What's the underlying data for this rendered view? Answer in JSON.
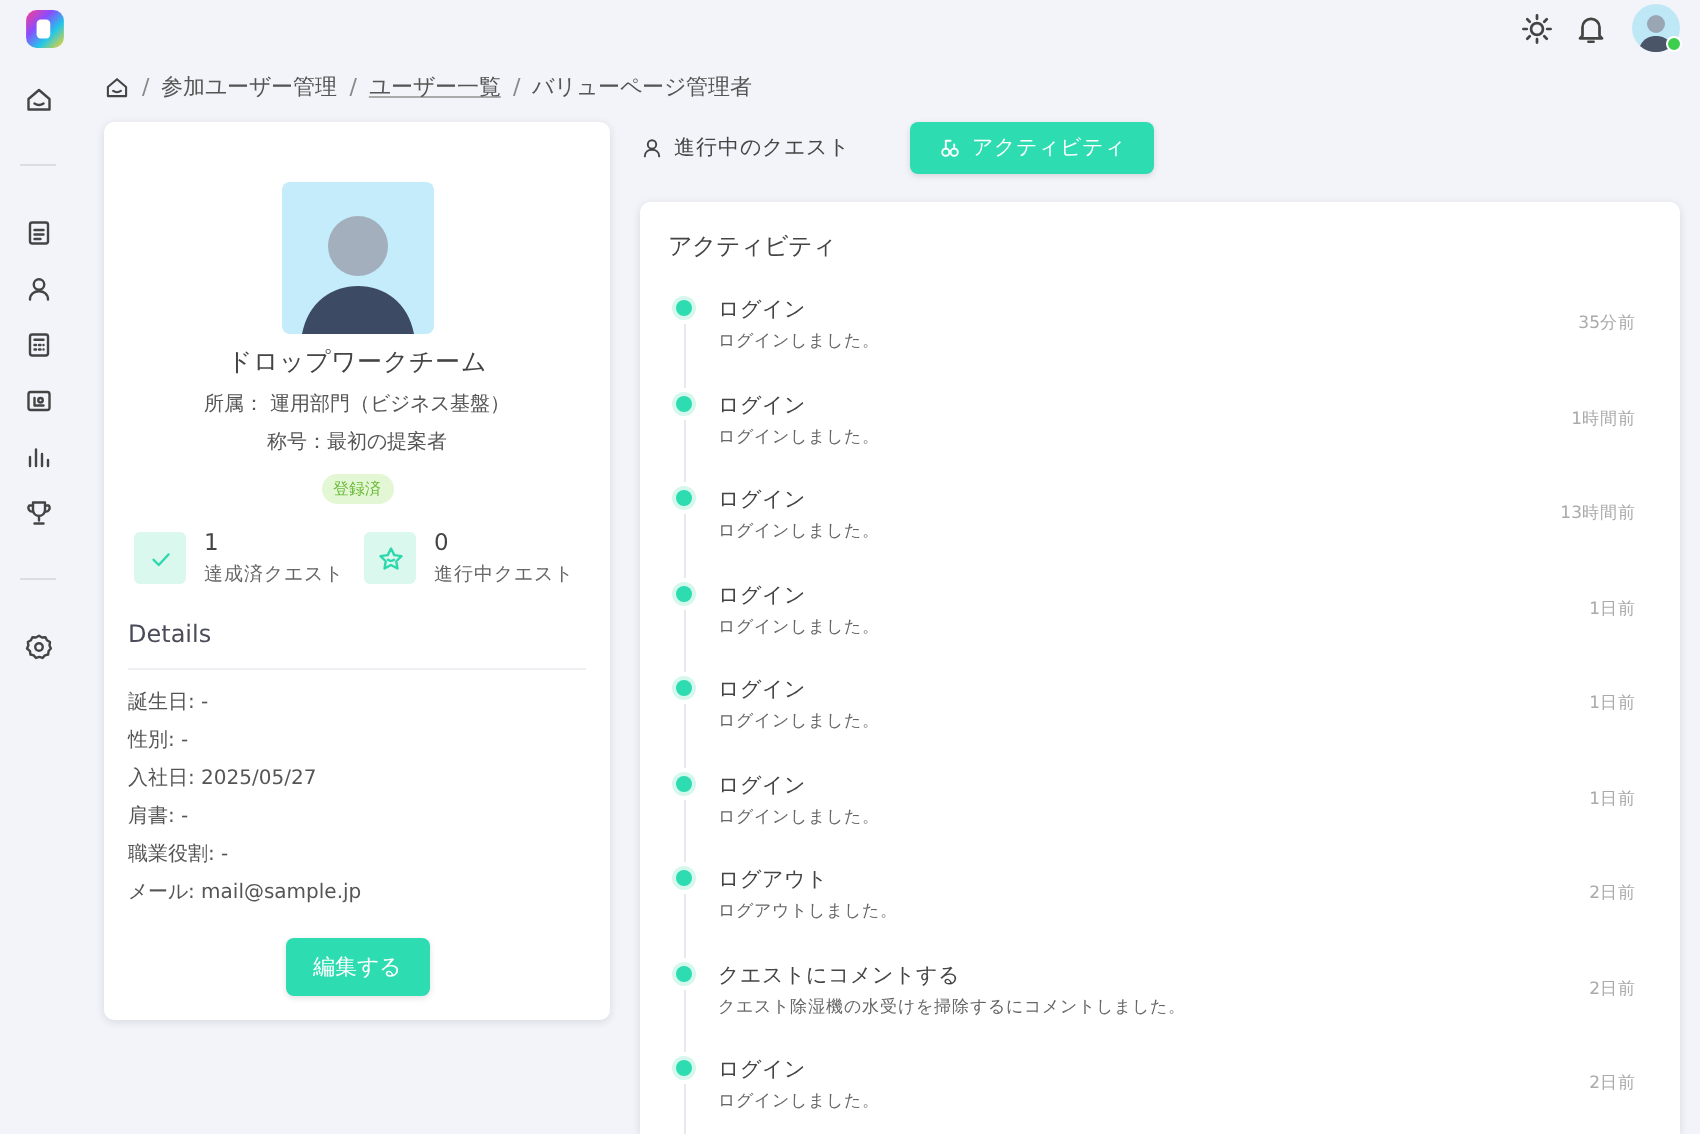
{
  "header": {
    "online": true
  },
  "breadcrumb": {
    "separator": "/",
    "items": [
      {
        "label": "参加ユーザー管理",
        "link": false
      },
      {
        "label": "ユーザー一覧",
        "link": true
      },
      {
        "label": "バリューページ管理者",
        "link": false
      }
    ]
  },
  "profile": {
    "name": "ドロップワークチーム",
    "department": "所属： 運用部門（ビジネス基盤）",
    "title": "称号：最初の提案者",
    "status": "登録済",
    "stats": [
      {
        "value": "1",
        "label": "達成済クエスト"
      },
      {
        "value": "0",
        "label": "進行中クエスト"
      }
    ],
    "details_heading": "Details",
    "details": [
      "誕生日: -",
      "性別: -",
      "入社日: 2025/05/27",
      "肩書: -",
      "職業役割: -",
      "メール: mail@sample.jp"
    ],
    "edit_button": "編集する"
  },
  "tabs": [
    {
      "label": "進行中のクエスト",
      "selected": false
    },
    {
      "label": "アクティビティ",
      "selected": true
    }
  ],
  "activity": {
    "heading": "アクティビティ",
    "items": [
      {
        "title": "ログイン",
        "description": "ログインしました。",
        "time": "35分前"
      },
      {
        "title": "ログイン",
        "description": "ログインしました。",
        "time": "1時間前"
      },
      {
        "title": "ログイン",
        "description": "ログインしました。",
        "time": "13時間前"
      },
      {
        "title": "ログイン",
        "description": "ログインしました。",
        "time": "1日前"
      },
      {
        "title": "ログイン",
        "description": "ログインしました。",
        "time": "1日前"
      },
      {
        "title": "ログイン",
        "description": "ログインしました。",
        "time": "1日前"
      },
      {
        "title": "ログアウト",
        "description": "ログアウトしました。",
        "time": "2日前"
      },
      {
        "title": "クエストにコメントする",
        "description": "クエスト除湿機の水受けを掃除するにコメントしました。",
        "time": "2日前"
      },
      {
        "title": "ログイン",
        "description": "ログインしました。",
        "time": "2日前"
      }
    ]
  }
}
